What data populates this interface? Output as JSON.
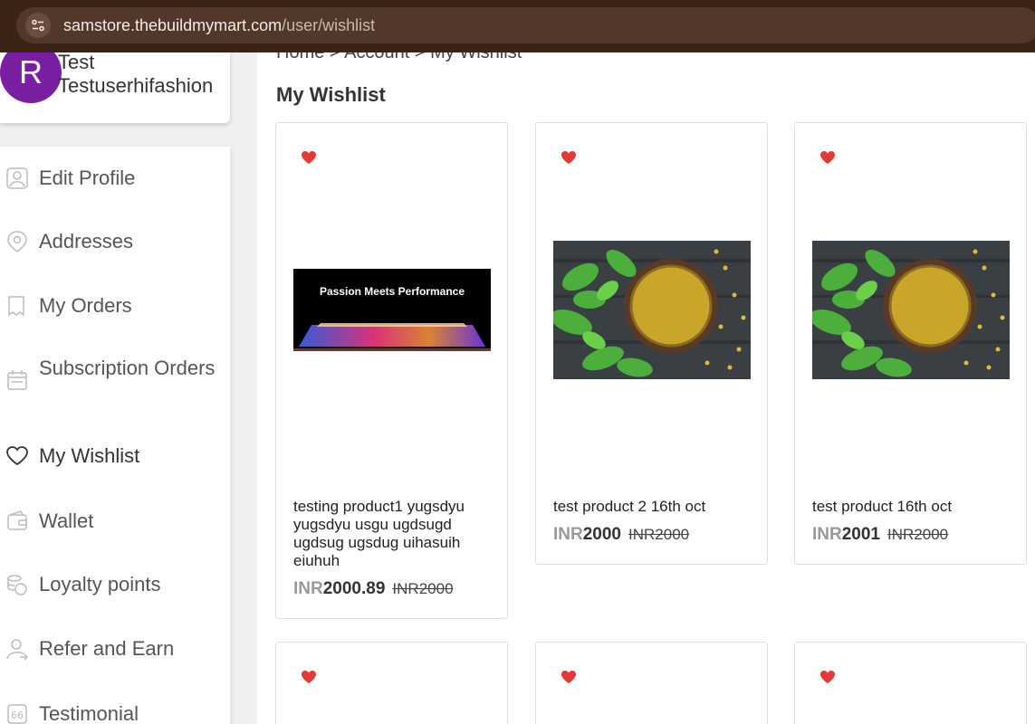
{
  "browser": {
    "url_host": "samstore.thebuildmymart.com",
    "url_path": "/user/wishlist"
  },
  "profile": {
    "avatar_letter": "R",
    "name_line1": "Test",
    "name_line2": "Testuserhifashion"
  },
  "menu": {
    "items": [
      {
        "label": "Edit Profile",
        "icon": "user-icon"
      },
      {
        "label": "Addresses",
        "icon": "location-pin-icon"
      },
      {
        "label": "My Orders",
        "icon": "receipt-icon"
      },
      {
        "label": "Subscription Orders",
        "icon": "calendar-icon"
      },
      {
        "label": "My Wishlist",
        "icon": "heart-icon"
      },
      {
        "label": "Wallet",
        "icon": "wallet-icon"
      },
      {
        "label": "Loyalty points",
        "icon": "coins-icon"
      },
      {
        "label": "Refer and Earn",
        "icon": "refer-icon"
      },
      {
        "label": "Testimonial",
        "icon": "quote-icon"
      }
    ],
    "active": "My Wishlist"
  },
  "breadcrumb": {
    "home": "Home",
    "sep": ">",
    "account": "Account",
    "current": "My Wishlist"
  },
  "page": {
    "title": "My Wishlist"
  },
  "products": [
    {
      "name": "testing product1 yugsdyu yugsdyu usgu ugdsugd ugdsug ugsdug uihasuih eiuhuh",
      "currency": "INR",
      "price": "2000.89",
      "old_price": "INR2000",
      "banner_text": "Passion Meets Performance"
    },
    {
      "name": "test product 2 16th oct",
      "currency": "INR",
      "price": "2000",
      "old_price": "INR2000"
    },
    {
      "name": "test product 16th oct",
      "currency": "INR",
      "price": "2001",
      "old_price": "INR2000"
    }
  ],
  "colors": {
    "heart": "#e53935",
    "avatar": "#7b1fa2",
    "topbar": "#3b2317"
  }
}
